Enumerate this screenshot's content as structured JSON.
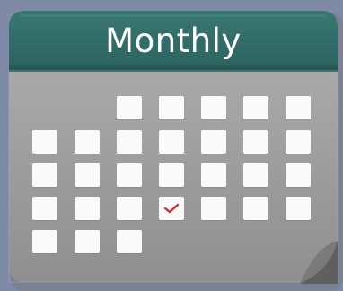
{
  "calendar": {
    "title": "Monthly",
    "header_color": "#2f6b68",
    "body_color": "#9a9a9a",
    "checkmark_color": "#d42a2a",
    "checked_day_index": 22,
    "day_count": 29
  }
}
